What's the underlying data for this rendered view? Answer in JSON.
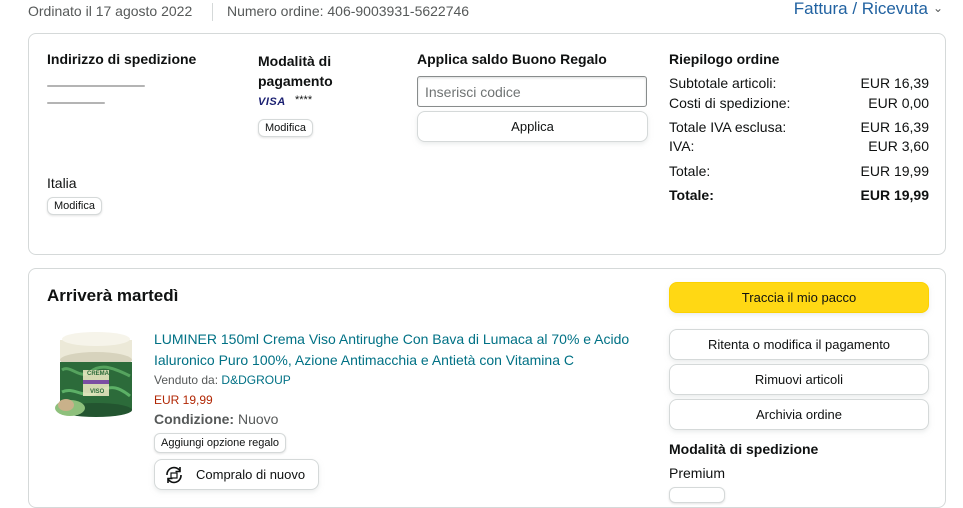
{
  "header": {
    "order_date": "Ordinato il 17 agosto 2022",
    "order_number": "Numero ordine: 406-9003931-5622746",
    "invoice_link": "Fattura / Ricevuta"
  },
  "shipping_address": {
    "title": "Indirizzo di spedizione",
    "country": "Italia",
    "edit_label": "Modifica"
  },
  "payment": {
    "title": "Modalità di pagamento",
    "card_brand": "VISA",
    "card_masked": "****",
    "edit_label": "Modifica"
  },
  "gift_card": {
    "title": "Applica saldo Buono Regalo",
    "input_placeholder": "Inserisci codice",
    "apply_label": "Applica"
  },
  "summary": {
    "title": "Riepilogo ordine",
    "rows": [
      {
        "label": "Subtotale articoli:",
        "value": "EUR 16,39"
      },
      {
        "label": "Costi di spedizione:",
        "value": "EUR 0,00"
      },
      {
        "label": "Totale IVA esclusa:",
        "value": "EUR 16,39"
      },
      {
        "label": "IVA:",
        "value": "EUR 3,60"
      },
      {
        "label": "Totale:",
        "value": "EUR 19,99"
      }
    ],
    "grand_total": {
      "label": "Totale:",
      "value": "EUR 19,99"
    }
  },
  "delivery": {
    "title": "Arriverà martedì",
    "track_label": "Traccia il mio pacco",
    "retry_payment_label": "Ritenta o modifica il pagamento",
    "remove_items_label": "Rimuovi articoli",
    "archive_label": "Archivia ordine",
    "shipping_mode_title": "Modalità di spedizione",
    "shipping_mode_value": "Premium"
  },
  "product": {
    "title_line1": "LUMINER 150ml Crema Viso Antirughe Con Bava di Lumaca al 70% e Acido",
    "title_line2": "Ialuronico Puro 100%, Azione Antimacchia e Antietà con Vitamina C",
    "sold_by_label": "Venduto da:",
    "seller": "D&DGROUP",
    "price": "EUR 19,99",
    "condition_label": "Condizione:",
    "condition_value": "Nuovo",
    "gift_option_label": "Aggiungi opzione regalo",
    "buy_again_label": "Compralo di nuovo",
    "jar_text_1": "CREMA",
    "jar_text_2": "VISO"
  },
  "colors": {
    "link": "#007185",
    "price": "#b12704",
    "track_button": "#ffd814",
    "invoice_link": "#2162a1"
  }
}
